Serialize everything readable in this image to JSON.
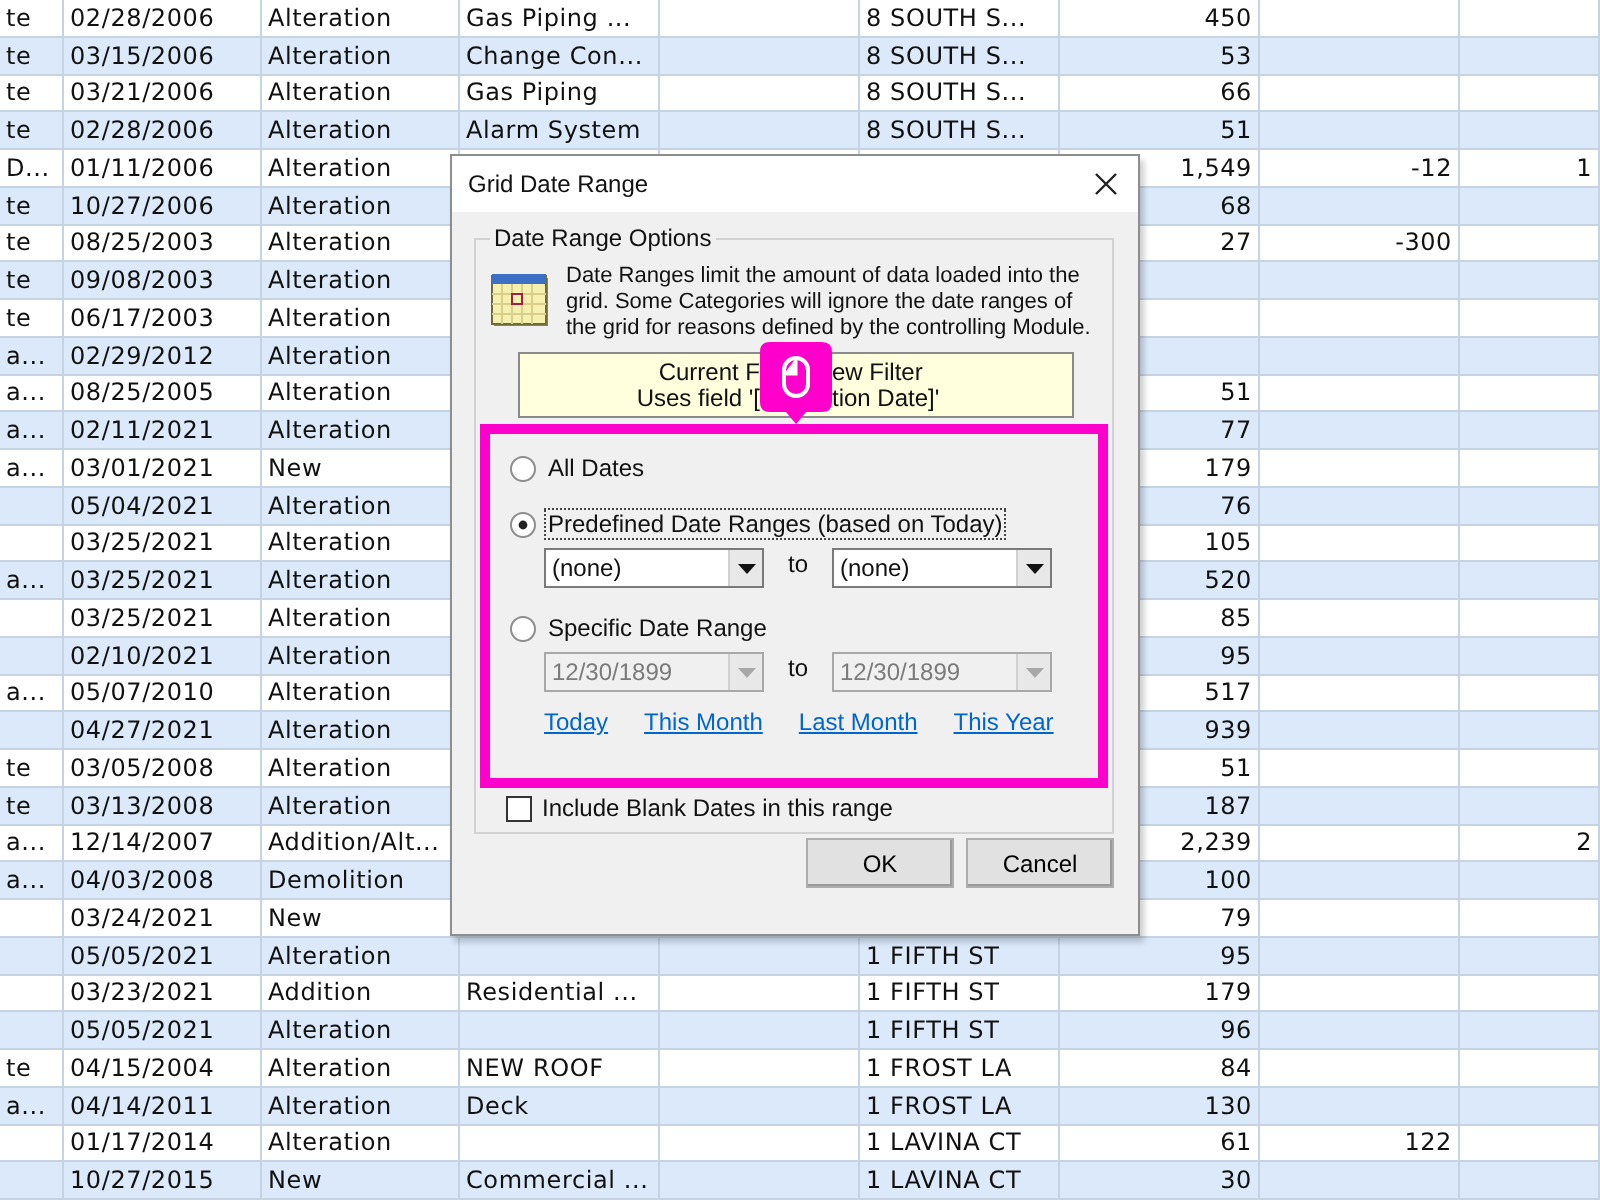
{
  "table": {
    "rows": [
      {
        "column_1": "te",
        "column_2": "02/28/2006",
        "column_3": "Alteration",
        "column_4": "Gas Piping ...",
        "column_6": "8 SOUTH S...",
        "column_7": "450"
      },
      {
        "column_1": "te",
        "column_2": "03/15/2006",
        "column_3": "Alteration",
        "column_4": "Change Con...",
        "column_6": "8 SOUTH S...",
        "column_7": "53"
      },
      {
        "column_1": "te",
        "column_2": "03/21/2006",
        "column_3": "Alteration",
        "column_4": "Gas Piping",
        "column_6": "8 SOUTH S...",
        "column_7": "66"
      },
      {
        "column_1": "te",
        "column_2": "02/28/2006",
        "column_3": "Alteration",
        "column_4": "Alarm System",
        "column_6": "8 SOUTH S...",
        "column_7": "51"
      },
      {
        "column_1": "D...",
        "column_2": "01/11/2006",
        "column_3": "Alteration",
        "column_7": "1,549",
        "column_8": "-12",
        "column_9": "1"
      },
      {
        "column_1": "te",
        "column_2": "10/27/2006",
        "column_3": "Alteration",
        "column_7": "68"
      },
      {
        "column_1": "te",
        "column_2": "08/25/2003",
        "column_3": "Alteration",
        "column_7": "27",
        "column_8": "-300"
      },
      {
        "column_1": "te",
        "column_2": "09/08/2003",
        "column_3": "Alteration"
      },
      {
        "column_1": "te",
        "column_2": "06/17/2003",
        "column_3": "Alteration"
      },
      {
        "column_1": "a...",
        "column_2": "02/29/2012",
        "column_3": "Alteration"
      },
      {
        "column_1": "a...",
        "column_2": "08/25/2005",
        "column_3": "Alteration",
        "column_7": "51"
      },
      {
        "column_1": "a...",
        "column_2": "02/11/2021",
        "column_3": "Alteration",
        "column_7": "77"
      },
      {
        "column_1": "a...",
        "column_2": "03/01/2021",
        "column_3": "New",
        "column_7": "179"
      },
      {
        "column_2": "05/04/2021",
        "column_3": "Alteration",
        "column_7": "76"
      },
      {
        "column_2": "03/25/2021",
        "column_3": "Alteration",
        "column_7": "105"
      },
      {
        "column_1": "a...",
        "column_2": "03/25/2021",
        "column_3": "Alteration",
        "column_7": "520"
      },
      {
        "column_2": "03/25/2021",
        "column_3": "Alteration",
        "column_7": "85"
      },
      {
        "column_2": "02/10/2021",
        "column_3": "Alteration",
        "column_7": "95"
      },
      {
        "column_1": "a...",
        "column_2": "05/07/2010",
        "column_3": "Alteration",
        "column_7": "517"
      },
      {
        "column_2": "04/27/2021",
        "column_3": "Alteration",
        "column_7": "939"
      },
      {
        "column_1": "te",
        "column_2": "03/05/2008",
        "column_3": "Alteration",
        "column_7": "51"
      },
      {
        "column_1": "te",
        "column_2": "03/13/2008",
        "column_3": "Alteration",
        "column_7": "187"
      },
      {
        "column_1": "a...",
        "column_2": "12/14/2007",
        "column_3": "Addition/Alt...",
        "column_7": "2,239",
        "column_9": "2"
      },
      {
        "column_1": "a...",
        "column_2": "04/03/2008",
        "column_3": "Demolition",
        "column_7": "100"
      },
      {
        "column_2": "03/24/2021",
        "column_3": "New",
        "column_7": "79"
      },
      {
        "column_2": "05/05/2021",
        "column_3": "Alteration",
        "column_6": "1 FIFTH ST",
        "column_7": "95"
      },
      {
        "column_2": "03/23/2021",
        "column_3": "Addition",
        "column_4": "Residential  ...",
        "column_6": "1 FIFTH ST",
        "column_7": "179"
      },
      {
        "column_2": "05/05/2021",
        "column_3": "Alteration",
        "column_6": "1 FIFTH ST",
        "column_7": "96"
      },
      {
        "column_1": "te",
        "column_2": "04/15/2004",
        "column_3": "Alteration",
        "column_4": "NEW ROOF",
        "column_6": "1 FROST LA",
        "column_7": "84"
      },
      {
        "column_1": "a...",
        "column_2": "04/14/2011",
        "column_3": "Alteration",
        "column_4": "Deck",
        "column_6": "1 FROST LA",
        "column_7": "130"
      },
      {
        "column_2": "01/17/2014",
        "column_3": "Alteration",
        "column_6": "1 LAVINA CT",
        "column_7": "61",
        "column_8": "122"
      },
      {
        "column_2": "10/27/2015",
        "column_3": "New",
        "column_4": "Commercial ...",
        "column_6": "1 LAVINA CT",
        "column_7": "30"
      }
    ]
  },
  "dialog": {
    "title": "Grid Date Range",
    "group_label": "Date Range Options",
    "description": "Date Ranges limit the amount of data loaded into the grid. Some Categories will ignore the date ranges of the grid for reasons defined by the controlling Module.",
    "filter_note": [
      {
        "left": "Current F",
        "right": "ew Filter"
      },
      {
        "left": "Uses field '[",
        "right": "tion Date]'"
      }
    ],
    "options": [
      {
        "kind": "plain",
        "label": "All Dates",
        "selected": false
      },
      {
        "kind": "range",
        "label": "Predefined Date Ranges (based on Today)",
        "selected": true,
        "from": {
          "value": "(none)",
          "disabled": false
        },
        "connector": "to",
        "to": {
          "value": "(none)",
          "disabled": false
        }
      },
      {
        "kind": "range",
        "label": "Specific Date Range",
        "selected": false,
        "from": {
          "value": "12/30/1899",
          "disabled": true
        },
        "connector": "to",
        "to": {
          "value": "12/30/1899",
          "disabled": true
        },
        "links": [
          "Today",
          "This Month",
          "Last Month",
          "This Year"
        ]
      }
    ],
    "include_blank": {
      "label": "Include Blank Dates in this range",
      "checked": false
    },
    "buttons": [
      "OK",
      "Cancel"
    ]
  }
}
